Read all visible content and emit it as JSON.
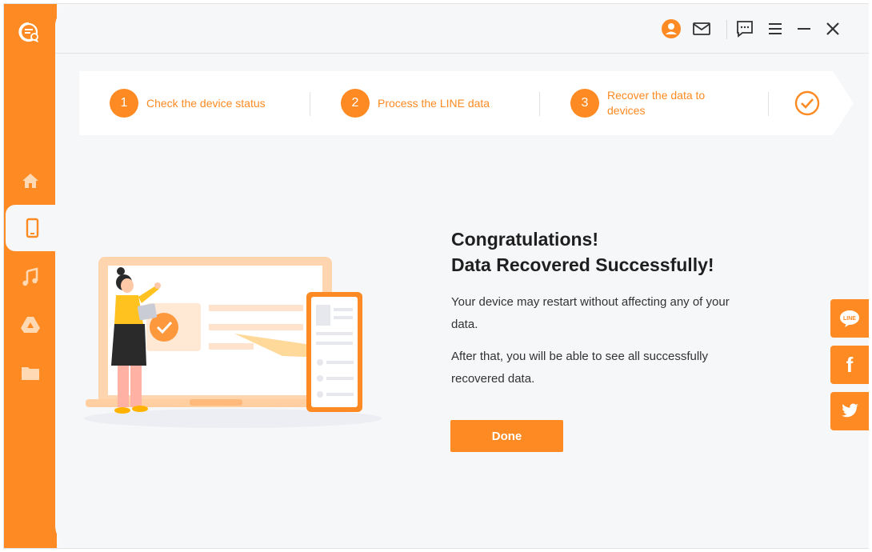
{
  "app": {
    "accent": "#fd8a22"
  },
  "sidebar": {
    "items": [
      {
        "icon": "home-icon"
      },
      {
        "icon": "phone-icon",
        "active": true
      },
      {
        "icon": "music-icon"
      },
      {
        "icon": "google-drive-icon"
      },
      {
        "icon": "folder-icon"
      }
    ]
  },
  "topbar": {
    "icons": [
      "user-icon",
      "mail-icon",
      "feedback-icon",
      "menu-icon",
      "minimize-icon",
      "close-icon"
    ]
  },
  "steps": [
    {
      "number": "1",
      "label": "Check the device status"
    },
    {
      "number": "2",
      "label": "Process the LINE data"
    },
    {
      "number": "3",
      "label_line1": "Recover the data to",
      "label_line2": "devices"
    }
  ],
  "result": {
    "title_line1": "Congratulations!",
    "title_line2": "Data Recovered Successfully!",
    "desc1_line1": "Your device may restart without affecting any of your",
    "desc1_line2": "data.",
    "desc2_line1": "After that, you will be able to see all successfully",
    "desc2_line2": "recovered data.",
    "done_label": "Done"
  },
  "share": {
    "line_label": "LINE",
    "facebook_label": "f"
  }
}
